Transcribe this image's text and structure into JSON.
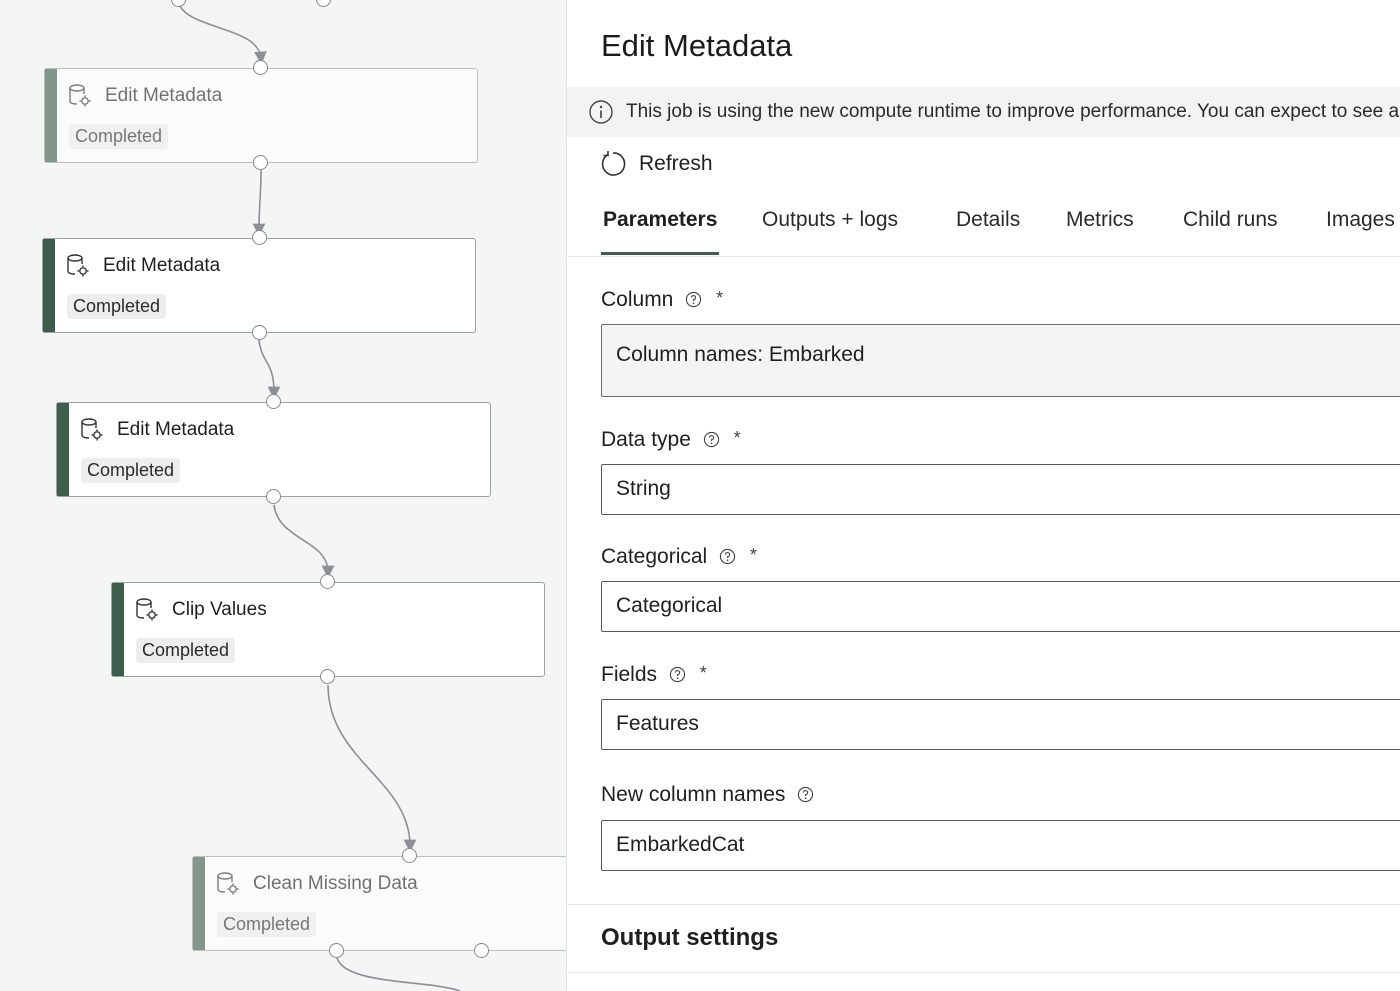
{
  "canvas": {
    "nodes": [
      {
        "title": "Edit Metadata",
        "status": "Completed"
      },
      {
        "title": "Edit Metadata",
        "status": "Completed"
      },
      {
        "title": "Edit Metadata",
        "status": "Completed"
      },
      {
        "title": "Clip Values",
        "status": "Completed"
      },
      {
        "title": "Clean Missing Data",
        "status": "Completed"
      }
    ],
    "node_icon": "dataset-gear-icon"
  },
  "panel": {
    "title": "Edit Metadata",
    "banner": "This job is using the new compute runtime to improve performance. You can expect to see a",
    "refresh_label": "Refresh",
    "tabs": [
      "Parameters",
      "Outputs + logs",
      "Details",
      "Metrics",
      "Child runs",
      "Images"
    ],
    "active_tab": "Parameters",
    "fields": {
      "column": {
        "label": "Column",
        "value": "Column names: Embarked"
      },
      "data_type": {
        "label": "Data type",
        "value": "String"
      },
      "categorical": {
        "label": "Categorical",
        "value": "Categorical"
      },
      "fields": {
        "label": "Fields",
        "value": "Features"
      },
      "new_column_names": {
        "label": "New column names",
        "value": "EmbarkedCat"
      }
    },
    "required_marker": "*",
    "output_settings_title": "Output settings"
  },
  "colors": {
    "accent": "#3d5e4a",
    "canvas_bg": "#f4f5f5",
    "banner_bg": "#f3f3f3"
  }
}
